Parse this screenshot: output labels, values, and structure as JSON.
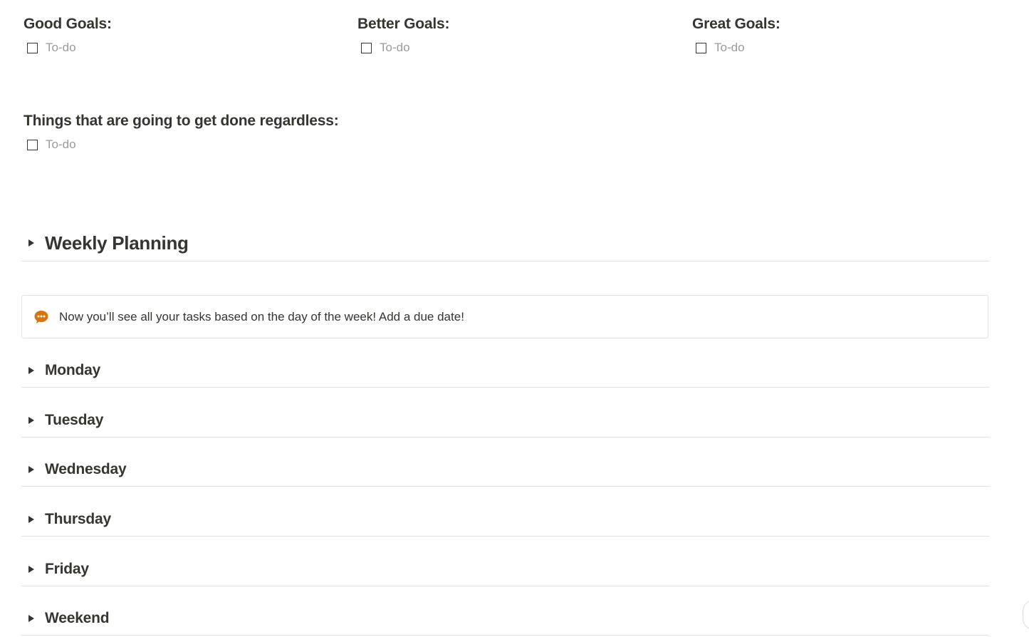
{
  "goals": [
    {
      "heading": "Good Goals:",
      "todo_placeholder": "To-do"
    },
    {
      "heading": "Better Goals:",
      "todo_placeholder": "To-do"
    },
    {
      "heading": "Great Goals:",
      "todo_placeholder": "To-do"
    }
  ],
  "regardless": {
    "heading": "Things that are going to get done regardless:",
    "todo_placeholder": "To-do"
  },
  "weekly_planning": {
    "title": "Weekly Planning"
  },
  "callout": {
    "icon": "chat-bubble-icon",
    "icon_color": "#d9730d",
    "text": "Now you’ll see all your tasks based on the day of the week! Add a due date!"
  },
  "days": [
    {
      "label": "Monday"
    },
    {
      "label": "Tuesday"
    },
    {
      "label": "Wednesday"
    },
    {
      "label": "Thursday"
    },
    {
      "label": "Friday"
    },
    {
      "label": "Weekend"
    }
  ],
  "colors": {
    "text": "#37352f",
    "placeholder": "#9b9a97",
    "divider": "#e3e2df"
  }
}
